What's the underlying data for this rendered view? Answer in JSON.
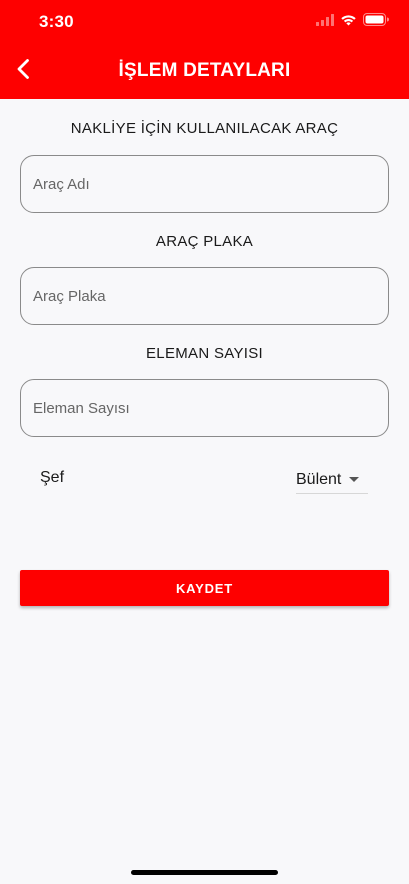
{
  "status_bar": {
    "time": "3:30"
  },
  "header": {
    "title": "İŞLEM DETAYLARI",
    "back_icon": "chevron-left-icon",
    "background_color": "#fe0000"
  },
  "form": {
    "vehicle": {
      "label": "NAKLİYE İÇİN KULLANILACAK ARAÇ",
      "placeholder": "Araç Adı",
      "value": ""
    },
    "plate": {
      "label": "ARAÇ PLAKA",
      "placeholder": "Araç Plaka",
      "value": ""
    },
    "staff_count": {
      "label": "ELEMAN SAYISI",
      "placeholder": "Eleman Sayısı",
      "value": ""
    },
    "chef": {
      "label": "Şef",
      "selected": "Bülent"
    },
    "save_label": "KAYDET"
  }
}
